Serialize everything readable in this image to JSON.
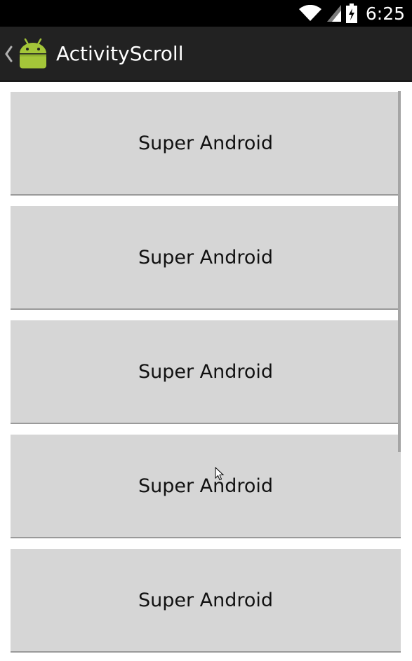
{
  "status_bar": {
    "time": "6:25",
    "icons": [
      "wifi-icon",
      "signal-icon",
      "battery-charging-icon"
    ]
  },
  "action_bar": {
    "up_icon": "chevron-left-icon",
    "app_icon": "android-icon",
    "title": "ActivityScroll"
  },
  "content": {
    "buttons": [
      {
        "label": "Super Android"
      },
      {
        "label": "Super Android"
      },
      {
        "label": "Super Android"
      },
      {
        "label": "Super Android"
      },
      {
        "label": "Super Android"
      }
    ]
  },
  "colors": {
    "status_bar_bg": "#000000",
    "action_bar_bg": "#222222",
    "button_bg": "#d6d6d6",
    "android_green": "#a4c639"
  }
}
